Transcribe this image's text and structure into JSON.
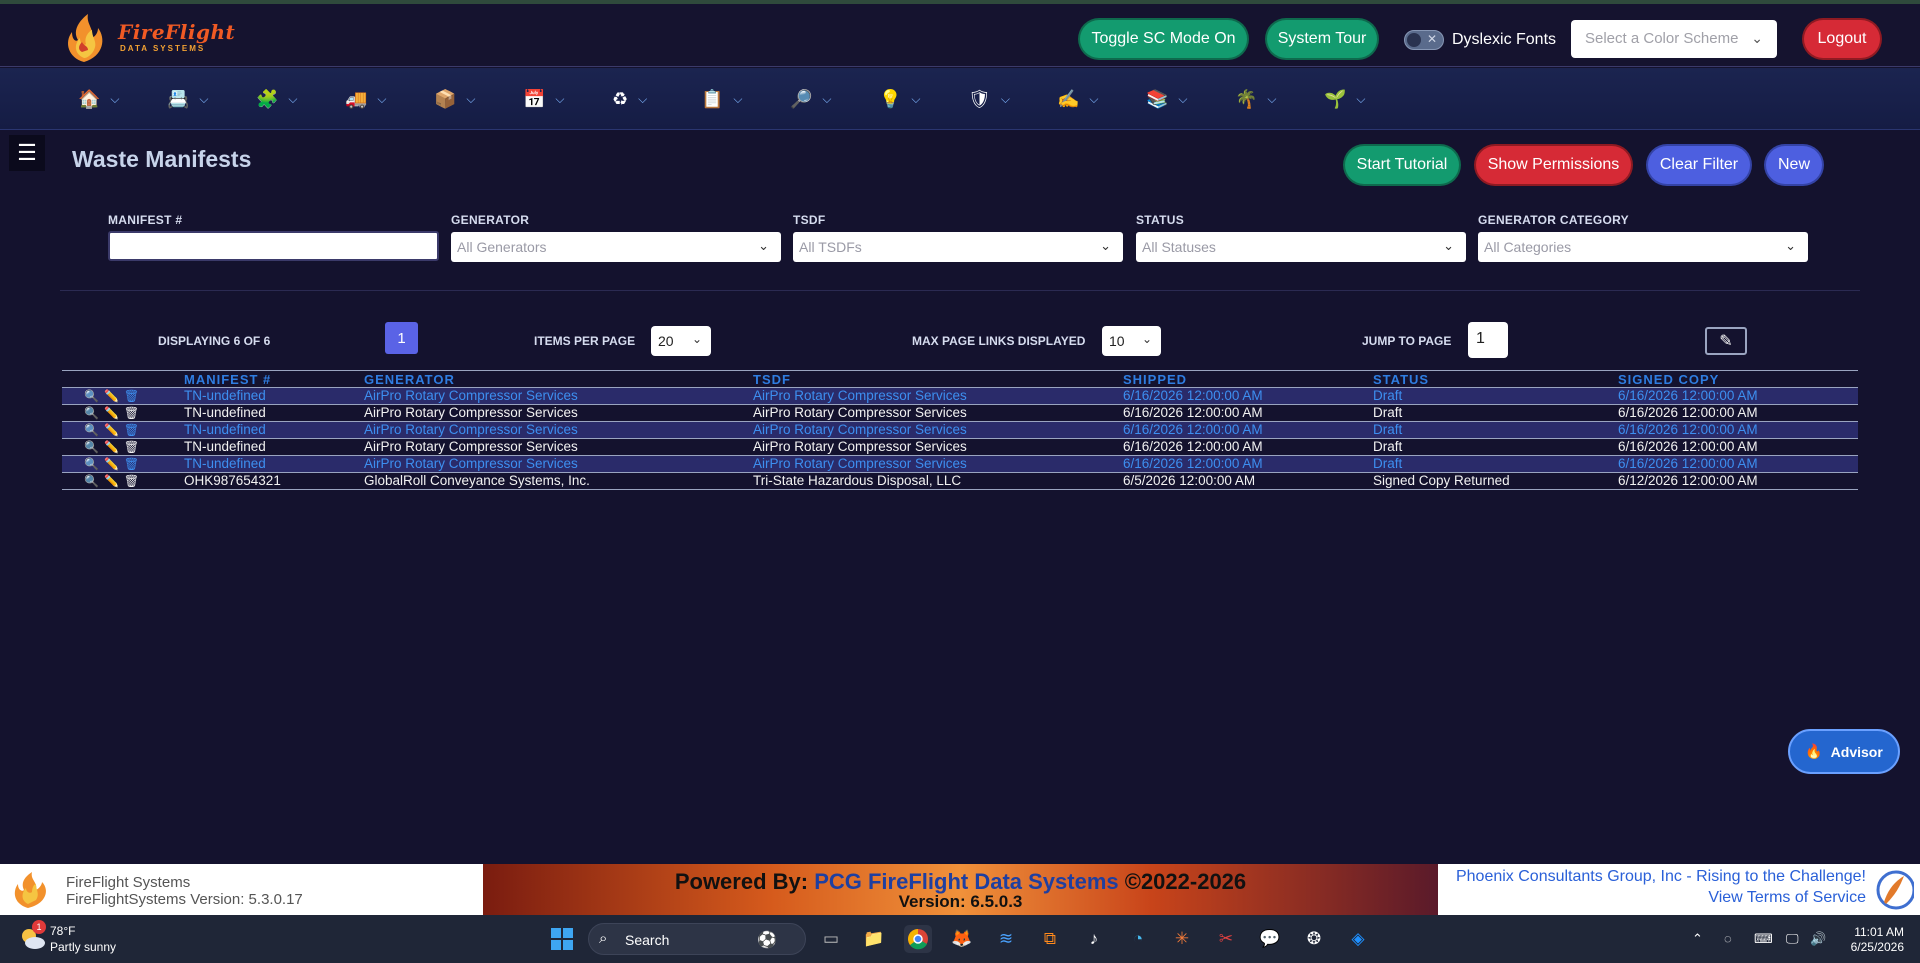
{
  "header": {
    "brand": "FireFlight",
    "brand_sub": "DATA SYSTEMS",
    "toggle_sc": "Toggle SC Mode On",
    "system_tour": "System Tour",
    "dyslexic": "Dyslexic Fonts",
    "scheme_placeholder": "Select a Color Scheme",
    "logout": "Logout"
  },
  "nav": {
    "items": [
      "home-icon",
      "document-icon",
      "puzzle-icon",
      "truck-icon",
      "box-icon",
      "calendar-icon",
      "leaf-recycle-icon",
      "clipboard-icon",
      "magnifier-icon",
      "lightbulb-icon",
      "shield-icon",
      "handshake-icon",
      "books-icon",
      "palm-icon",
      "seedling-icon"
    ]
  },
  "page": {
    "title": "Waste Manifests",
    "start_tutorial": "Start Tutorial",
    "show_permissions": "Show Permissions",
    "clear_filter": "Clear Filter",
    "new": "New"
  },
  "filters": {
    "manifest_label": "MANIFEST #",
    "manifest_value": "",
    "generator_label": "GENERATOR",
    "generator_value": "All Generators",
    "tsdf_label": "TSDF",
    "tsdf_value": "All TSDFs",
    "status_label": "STATUS",
    "status_value": "All Statuses",
    "category_label": "GENERATOR CATEGORY",
    "category_value": "All Categories"
  },
  "pager": {
    "displaying": "DISPLAYING 6 OF 6",
    "current_page": "1",
    "items_per_page_label": "ITEMS PER PAGE",
    "items_per_page": "20",
    "max_links_label": "MAX PAGE LINKS DISPLAYED",
    "max_links": "10",
    "jump_label": "JUMP TO PAGE",
    "jump_value": "1"
  },
  "table": {
    "columns": [
      "MANIFEST #",
      "GENERATOR",
      "TSDF",
      "SHIPPED",
      "STATUS",
      "SIGNED COPY"
    ],
    "rows": [
      {
        "manifest": "TN-undefined",
        "generator": "AirPro Rotary Compressor Services",
        "tsdf": "AirPro Rotary Compressor Services",
        "shipped": "6/16/2026 12:00:00 AM",
        "status": "Draft",
        "signed": "6/16/2026 12:00:00 AM"
      },
      {
        "manifest": "TN-undefined",
        "generator": "AirPro Rotary Compressor Services",
        "tsdf": "AirPro Rotary Compressor Services",
        "shipped": "6/16/2026 12:00:00 AM",
        "status": "Draft",
        "signed": "6/16/2026 12:00:00 AM"
      },
      {
        "manifest": "TN-undefined",
        "generator": "AirPro Rotary Compressor Services",
        "tsdf": "AirPro Rotary Compressor Services",
        "shipped": "6/16/2026 12:00:00 AM",
        "status": "Draft",
        "signed": "6/16/2026 12:00:00 AM"
      },
      {
        "manifest": "TN-undefined",
        "generator": "AirPro Rotary Compressor Services",
        "tsdf": "AirPro Rotary Compressor Services",
        "shipped": "6/16/2026 12:00:00 AM",
        "status": "Draft",
        "signed": "6/16/2026 12:00:00 AM"
      },
      {
        "manifest": "TN-undefined",
        "generator": "AirPro Rotary Compressor Services",
        "tsdf": "AirPro Rotary Compressor Services",
        "shipped": "6/16/2026 12:00:00 AM",
        "status": "Draft",
        "signed": "6/16/2026 12:00:00 AM"
      },
      {
        "manifest": "OHK987654321",
        "generator": "GlobalRoll Conveyance Systems, Inc.",
        "tsdf": "Tri-State Hazardous Disposal, LLC",
        "shipped": "6/5/2026 12:00:00 AM",
        "status": "Signed Copy Returned",
        "signed": "6/12/2026 12:00:00 AM"
      }
    ]
  },
  "advisor": "Advisor",
  "footer": {
    "title": "FireFlight Systems",
    "version": "FireFlightSystems Version: 5.3.0.17",
    "powered_prefix": "Powered By: ",
    "powered_name": "PCG FireFlight Data Systems",
    "powered_suffix": " ©2022-2026",
    "banner_version": "Version: 6.5.0.3",
    "company": "Phoenix Consultants Group, Inc - Rising to the Challenge!",
    "terms": "View Terms of Service"
  },
  "taskbar": {
    "temp": "78°F",
    "weather": "Partly sunny",
    "weather_badge": "1",
    "search": "Search",
    "time": "11:01 AM",
    "date": "6/25/2026"
  },
  "colors": {
    "accent_teal": "#139b6f",
    "accent_red": "#d62a36",
    "accent_blue": "#4d5fe0",
    "link_blue": "#3d8ff0"
  }
}
